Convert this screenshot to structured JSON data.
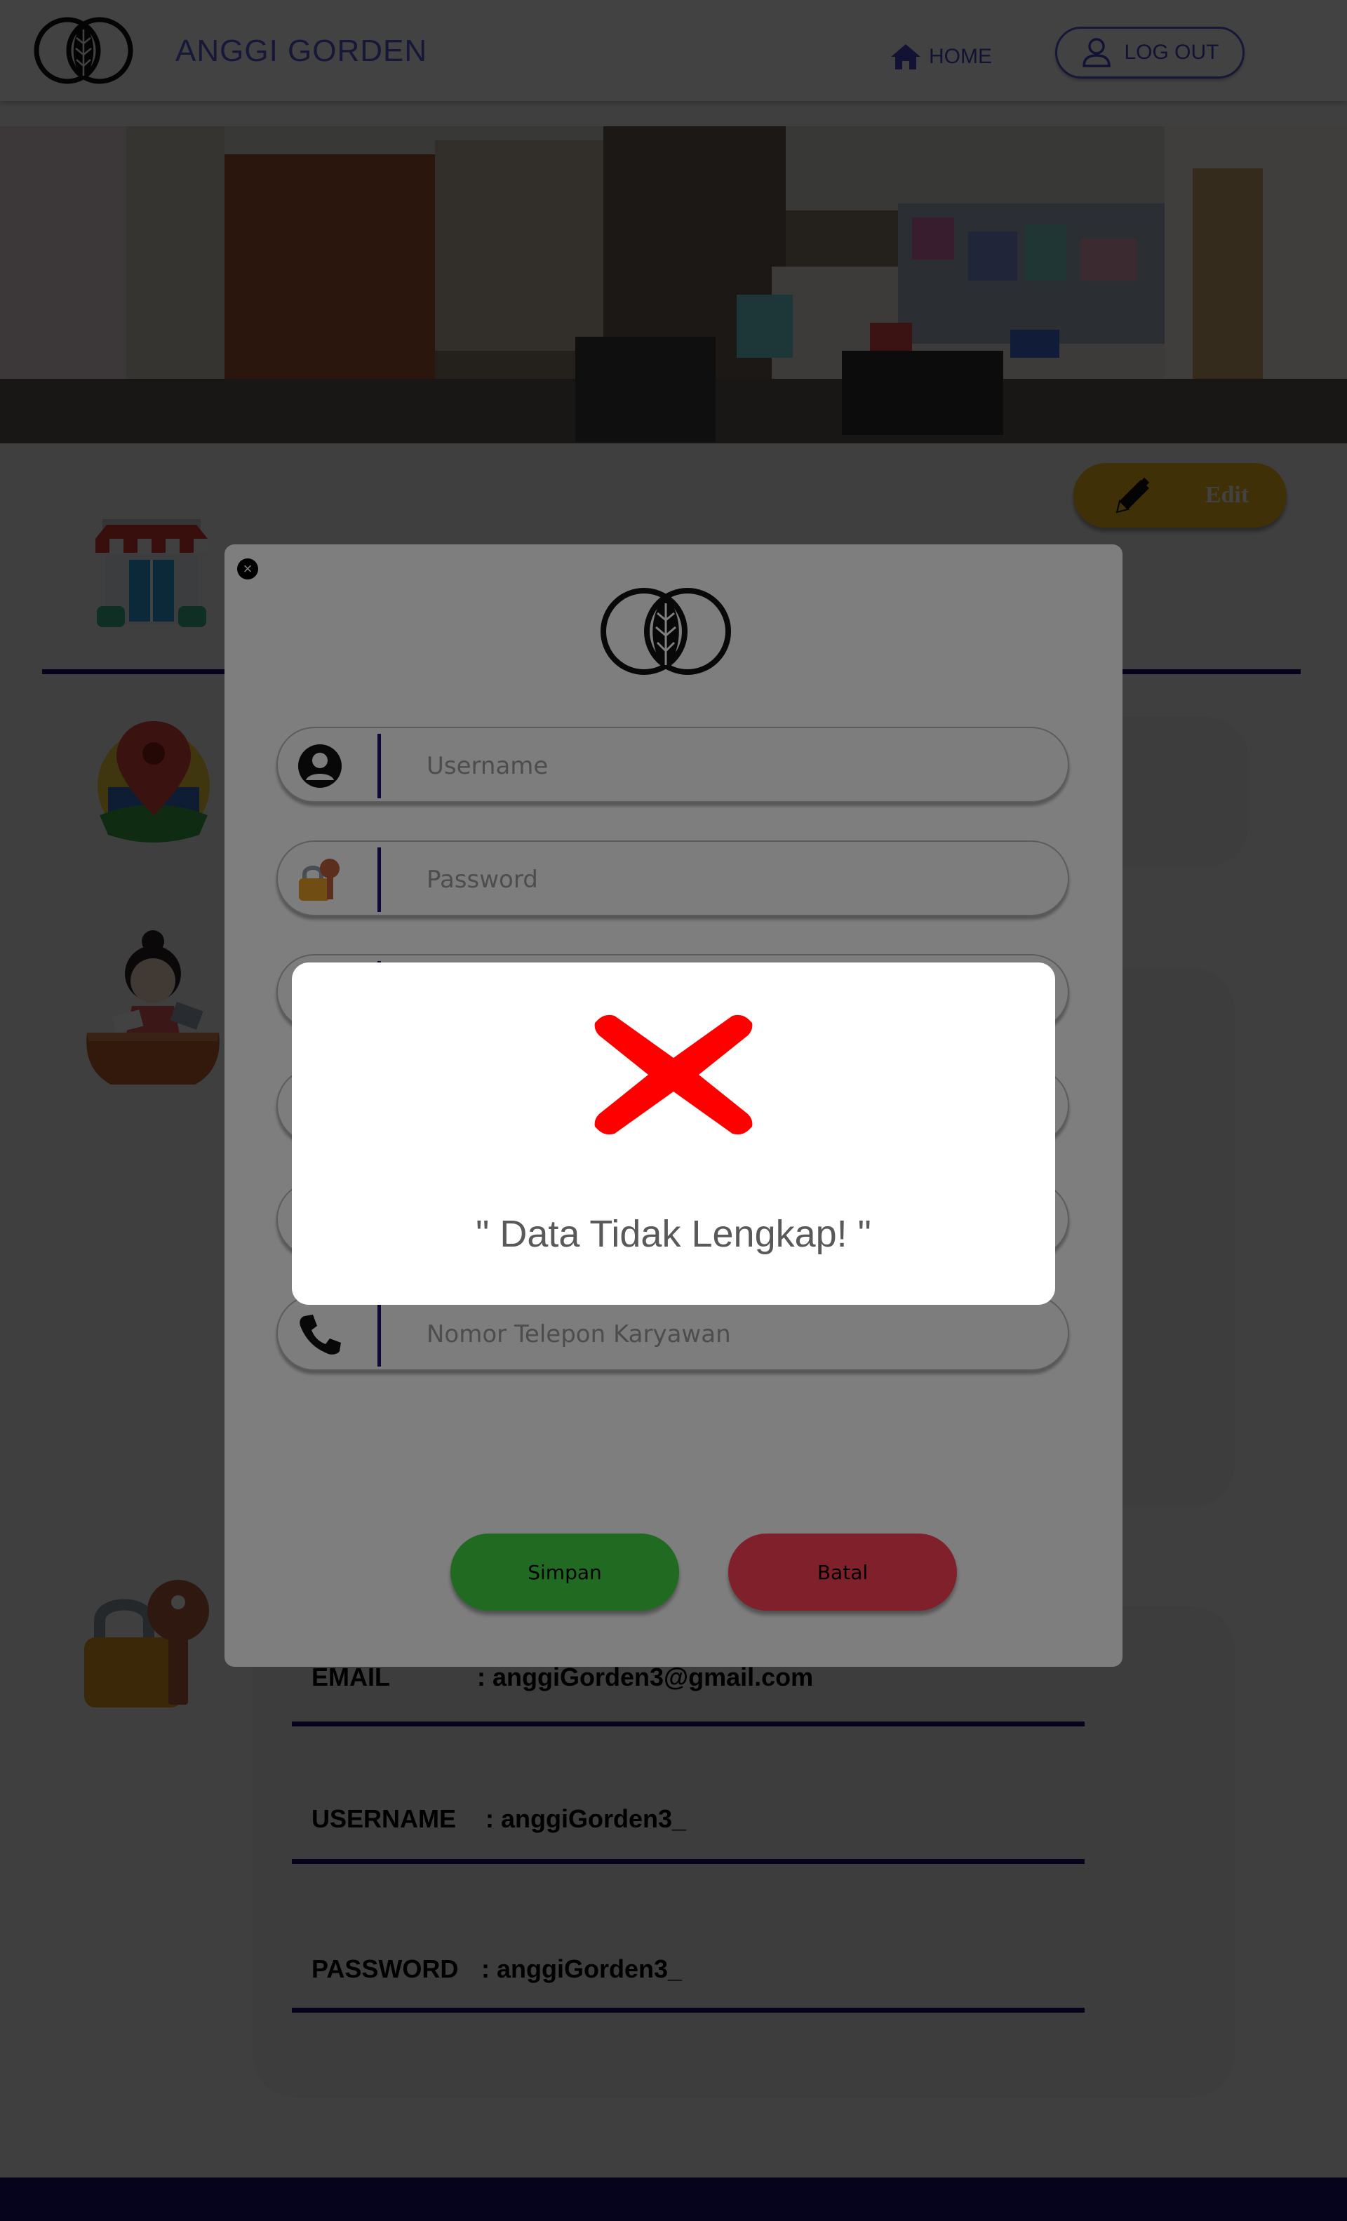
{
  "header": {
    "brand_name": "ANGGI GORDEN",
    "home_label": "HOME",
    "logout_label": "LOG OUT"
  },
  "profile": {
    "edit_label": "Edit",
    "email_label": "EMAIL",
    "email_value": ": anggiGorden3@gmail.com",
    "username_label": "USERNAME",
    "username_value": ": anggiGorden3_",
    "password_label": "PASSWORD",
    "password_value": ": anggiGorden3_"
  },
  "form": {
    "close_symbol": "×",
    "username_placeholder": "Username",
    "password_placeholder": "Password",
    "phone_placeholder": "Nomor Telepon Karyawan",
    "save_label": "Simpan",
    "cancel_label": "Batal"
  },
  "alert": {
    "message": "\" Data Tidak Lengkap! \"",
    "icon": "red-x-error-icon"
  },
  "colors": {
    "brand_blue": "#5a5ad6",
    "navy": "#1a1170",
    "edit_yellow": "#f4ba1b",
    "save_green": "#43d443",
    "cancel_red": "#ff4156",
    "error_red": "#ff0000"
  }
}
